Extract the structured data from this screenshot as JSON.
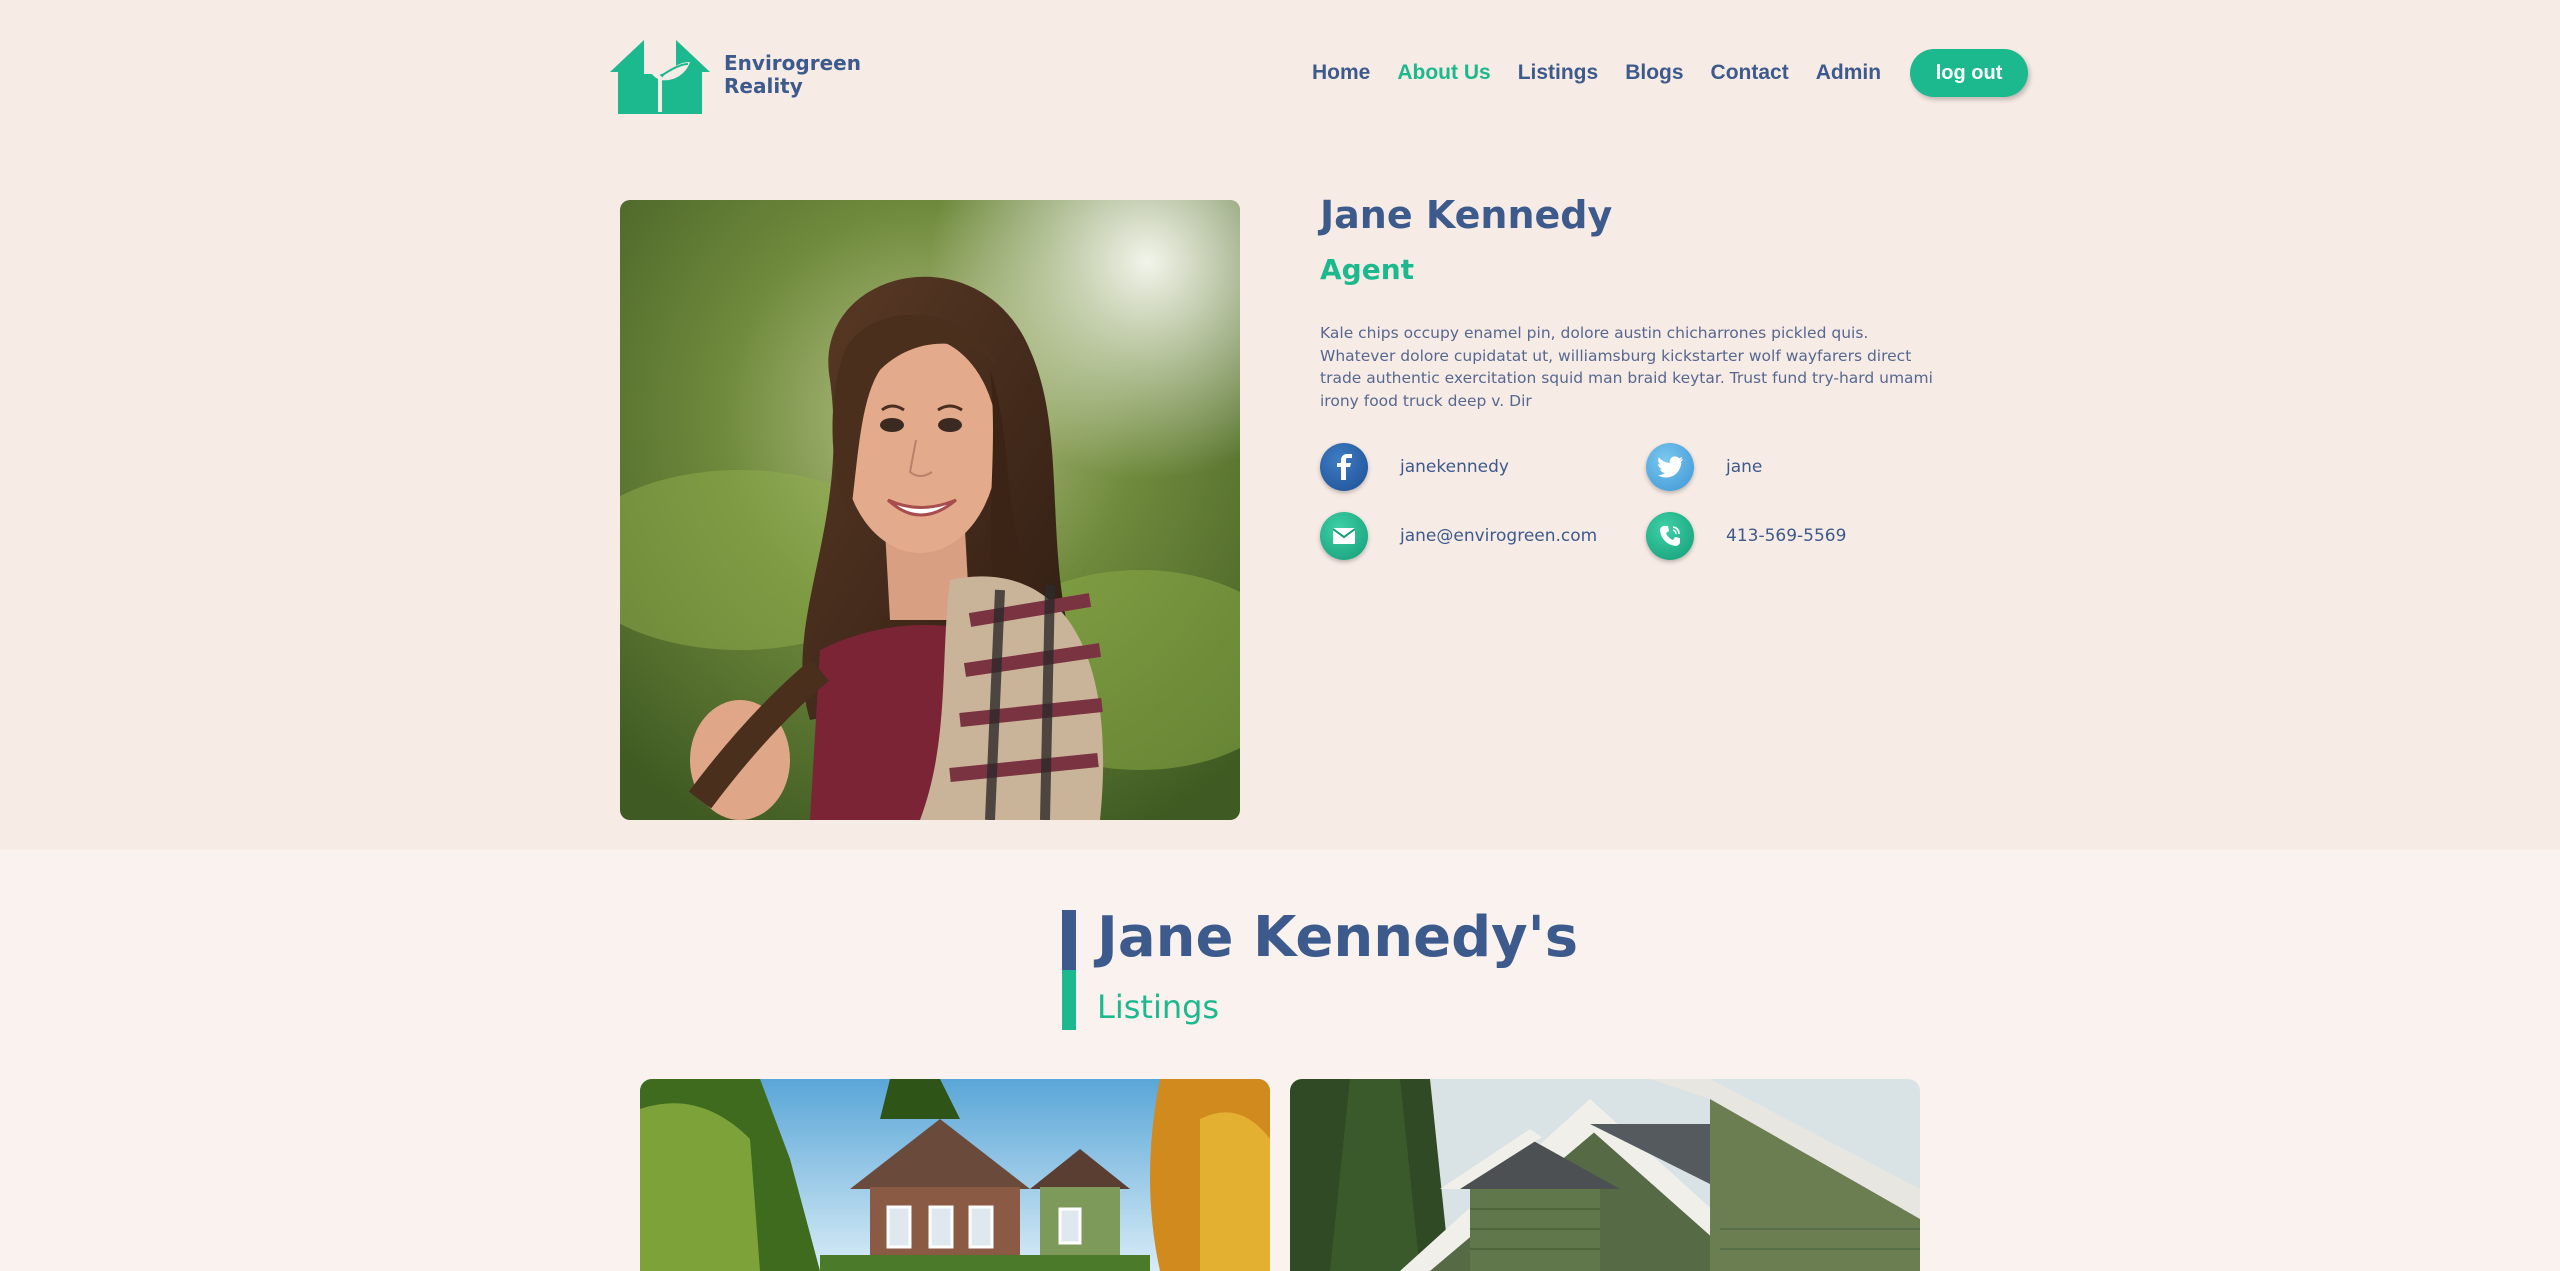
{
  "brand": {
    "line1": "Envirogreen",
    "line2": "Reality"
  },
  "nav": {
    "items": [
      {
        "label": "Home",
        "active": false
      },
      {
        "label": "About Us",
        "active": true
      },
      {
        "label": "Listings",
        "active": false
      },
      {
        "label": "Blogs",
        "active": false
      },
      {
        "label": "Contact",
        "active": false
      },
      {
        "label": "Admin",
        "active": false
      }
    ],
    "logout_label": "log out"
  },
  "agent": {
    "name": "Jane Kennedy",
    "role": "Agent",
    "bio": "Kale chips occupy enamel pin, dolore austin chicharrones pickled quis. Whatever dolore cupidatat ut, williamsburg kickstarter wolf wayfarers direct trade authentic exercitation squid man braid keytar. Trust fund try-hard umami irony food truck deep v. Dir",
    "contacts": {
      "facebook": "janekennedy",
      "twitter": "jane",
      "email": "jane@envirogreen.com",
      "phone": "413-569-5569"
    }
  },
  "listings_section": {
    "title": "Jane Kennedy's",
    "subtitle": "Listings"
  },
  "colors": {
    "primary_blue": "#3d5a8c",
    "accent_green": "#1cb98f",
    "background": "#f7ebe5"
  },
  "icons": [
    "house-leaf-logo-icon",
    "facebook-icon",
    "twitter-icon",
    "mail-icon",
    "phone-icon"
  ]
}
